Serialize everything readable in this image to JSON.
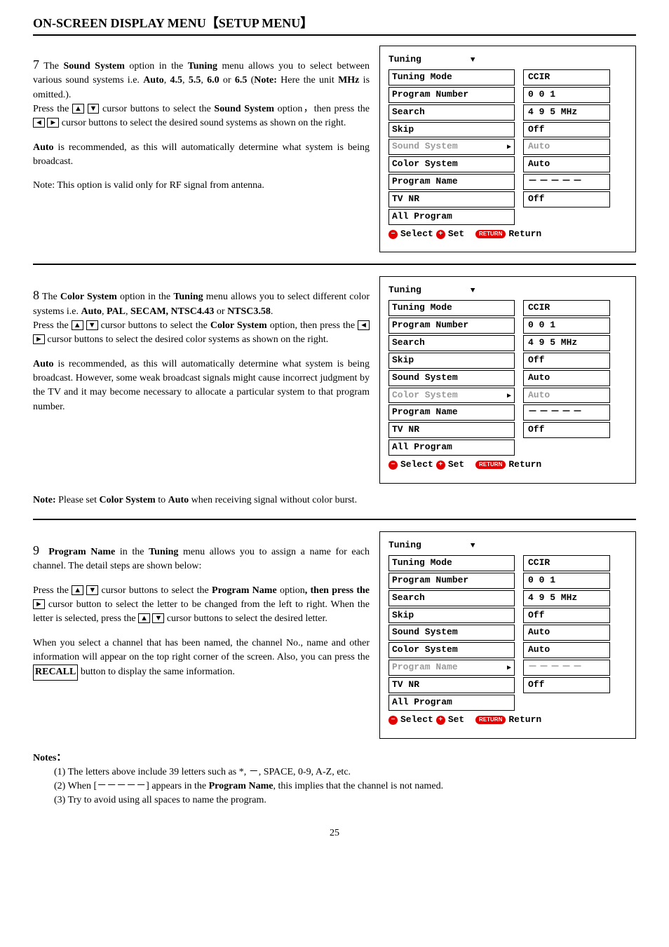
{
  "heading": "ON-SCREEN DISPLAY MENU【SETUP MENU】",
  "step7": {
    "num": "7",
    "body1_a": "The ",
    "body1_b": "Sound System",
    "body1_c": " option in the ",
    "body1_d": "Tuning",
    "body1_e": " menu allows you to select between various sound systems i.e. ",
    "body1_f": "Auto",
    "body1_g": ", ",
    "body1_h": "4.5",
    "body1_i": ", ",
    "body1_j": "5.5",
    "body1_k": ", ",
    "body1_l": "6.0",
    "body1_m": " or ",
    "body1_n": "6.5",
    "body1_o": " (",
    "body1_p": "Note:",
    "body1_q": " Here the unit ",
    "body1_r": "MHz",
    "body1_s": " is omitted.).",
    "press_a": "Press the ",
    "press_b": " cursor buttons to select the ",
    "press_c": "Sound System",
    "press_d": " option，then press the ",
    "press_e": " cursor buttons to select the desired sound systems as shown on the right.",
    "auto_a": "Auto",
    "auto_b": " is recommended, as this will automatically determine what system is being broadcast.",
    "note": "Note: This option is valid only for RF signal from antenna."
  },
  "step8": {
    "num": "8",
    "body1_a": "The ",
    "body1_b": "Color System",
    "body1_c": " option in the ",
    "body1_d": "Tuning",
    "body1_e": " menu allows you to select different color systems i.e. ",
    "body1_f": "Auto",
    "body1_g": ", ",
    "body1_h": "PAL",
    "body1_i": ", ",
    "body1_j": "SECAM, NTSC4.43",
    "body1_k": " or ",
    "body1_l": "NTSC3.58",
    "body1_m": ".",
    "press_a": "Press the ",
    "press_b": " cursor buttons to select the ",
    "press_c": "Color System",
    "press_d": " option, then press the ",
    "press_e": " cursor buttons to select the desired color systems as shown on the right.",
    "auto_a": "Auto",
    "auto_b": " is recommended, as this will automatically determine what system is being broadcast. However, some weak broadcast signals might cause incorrect judgment by the TV and it may become necessary to allocate a particular system to that program number.",
    "note_a": "Note:",
    "note_b": " Please set ",
    "note_c": "Color System",
    "note_d": " to ",
    "note_e": "Auto",
    "note_f": " when receiving signal without color burst."
  },
  "step9": {
    "num": "9",
    "body1_a": "Program Name",
    "body1_b": " in the ",
    "body1_c": "Tuning",
    "body1_d": " menu allows you to assign a name for each channel. The detail steps are shown below:",
    "press_a": "Press the ",
    "press_b": " cursor buttons to select the ",
    "press_c": "Program Name",
    "press_d": " option",
    "press_e": ", then press the ",
    "press_f": " cursor button to select the letter to be changed from the left to right. When the letter is selected, press the ",
    "press_g": " cursor buttons to select the desired letter.",
    "para2_a": "When you select a channel that has been named, the channel No., name and other information will appear on the top right corner of the screen. Also, you can press the ",
    "para2_b": "RECALL",
    "para2_c": " button to display the same information."
  },
  "notes": {
    "head": "Notes：",
    "n1": "(1) The letters above include 39 letters such as *, －, SPACE, 0-9, A-Z, etc.",
    "n2_a": "(2) When [－－－－－] appears in the ",
    "n2_b": "Program Name",
    "n2_c": ", this implies that the channel is not named.",
    "n3": "(3) Try to avoid using all spaces to name the program."
  },
  "arrows": {
    "up": "▲",
    "down": "▼",
    "left": "◄",
    "right": "►"
  },
  "menu": {
    "title": "Tuning",
    "items": {
      "tuning_mode": "Tuning Mode",
      "program_number": "Program Number",
      "search": "Search",
      "skip": "Skip",
      "sound_system": "Sound System",
      "color_system": "Color System",
      "program_name": "Program Name",
      "tv_nr": "TV NR",
      "all_program": "All Program"
    },
    "values": {
      "ccir": "CCIR",
      "pn": "0 0 1",
      "mhz": "4 9 5 MHz",
      "off": "Off",
      "auto": "Auto",
      "dashes": "－－－－－"
    },
    "footer": {
      "select": "Select",
      "set": "Set",
      "return_pill": "RETURN",
      "return": "Return",
      "minus": "−",
      "plus": "+"
    }
  },
  "page": "25"
}
